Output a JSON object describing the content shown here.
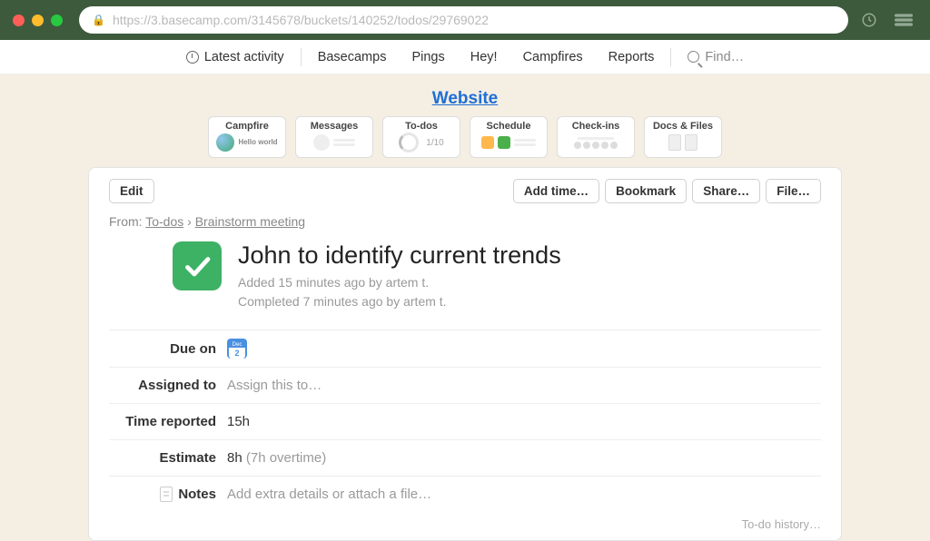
{
  "chrome": {
    "url": "https://3.basecamp.com/3145678/buckets/140252/todos/29769022"
  },
  "topnav": {
    "latest_activity": "Latest activity",
    "basecamps": "Basecamps",
    "pings": "Pings",
    "hey": "Hey!",
    "campfires": "Campfires",
    "reports": "Reports",
    "find": "Find…"
  },
  "project": {
    "title": "Website"
  },
  "tabs": {
    "campfire": {
      "label": "Campfire",
      "snippet": "Hello world"
    },
    "messages": {
      "label": "Messages"
    },
    "todos": {
      "label": "To-dos",
      "count": "1/10"
    },
    "schedule": {
      "label": "Schedule"
    },
    "checkins": {
      "label": "Check-ins"
    },
    "docs": {
      "label": "Docs & Files"
    }
  },
  "toolbar": {
    "edit": "Edit",
    "add_time": "Add time…",
    "bookmark": "Bookmark",
    "share": "Share…",
    "file": "File…"
  },
  "breadcrumb": {
    "from_label": "From:",
    "todos": "To-dos",
    "list": "Brainstorm meeting"
  },
  "todo": {
    "title": "John to identify current trends",
    "added": "Added 15 minutes ago by artem t.",
    "completed": "Completed 7 minutes ago by artem t."
  },
  "fields": {
    "due_on": {
      "label": "Due on",
      "month": "Dec",
      "day": "2"
    },
    "assigned_to": {
      "label": "Assigned to",
      "placeholder": "Assign this to…"
    },
    "time_reported": {
      "label": "Time reported",
      "value": "15h"
    },
    "estimate": {
      "label": "Estimate",
      "value": "8h",
      "overtime": " (7h overtime)"
    },
    "notes": {
      "label": "Notes",
      "placeholder": "Add extra details or attach a file…"
    }
  },
  "history_link": "To-do history…"
}
